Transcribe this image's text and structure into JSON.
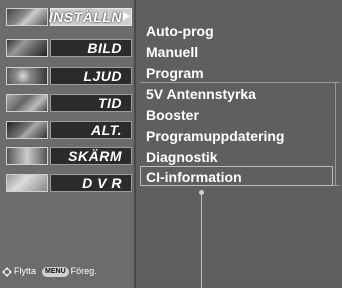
{
  "left_menu": {
    "items": [
      {
        "label": "INSTÄLLN",
        "active": true
      },
      {
        "label": "BILD"
      },
      {
        "label": "LJUD"
      },
      {
        "label": "TID"
      },
      {
        "label": "ALT."
      },
      {
        "label": "SKÄRM"
      },
      {
        "label": "D V R"
      }
    ]
  },
  "footer": {
    "move_label": "Flytta",
    "menu_key": "MENU",
    "back_label": "Föreg."
  },
  "submenu": {
    "items": [
      "Auto-prog",
      "Manuell",
      "Program",
      "5V Antennstyrka",
      "Booster",
      "Programuppdatering",
      "Diagnostik",
      "CI-information"
    ],
    "selected_index": 7
  },
  "colors": {
    "panel_bg": "#5f5f5f",
    "menu_bar": "#2b2b2b",
    "active_bar": "#cfcfcf",
    "text": "#ffffff"
  }
}
